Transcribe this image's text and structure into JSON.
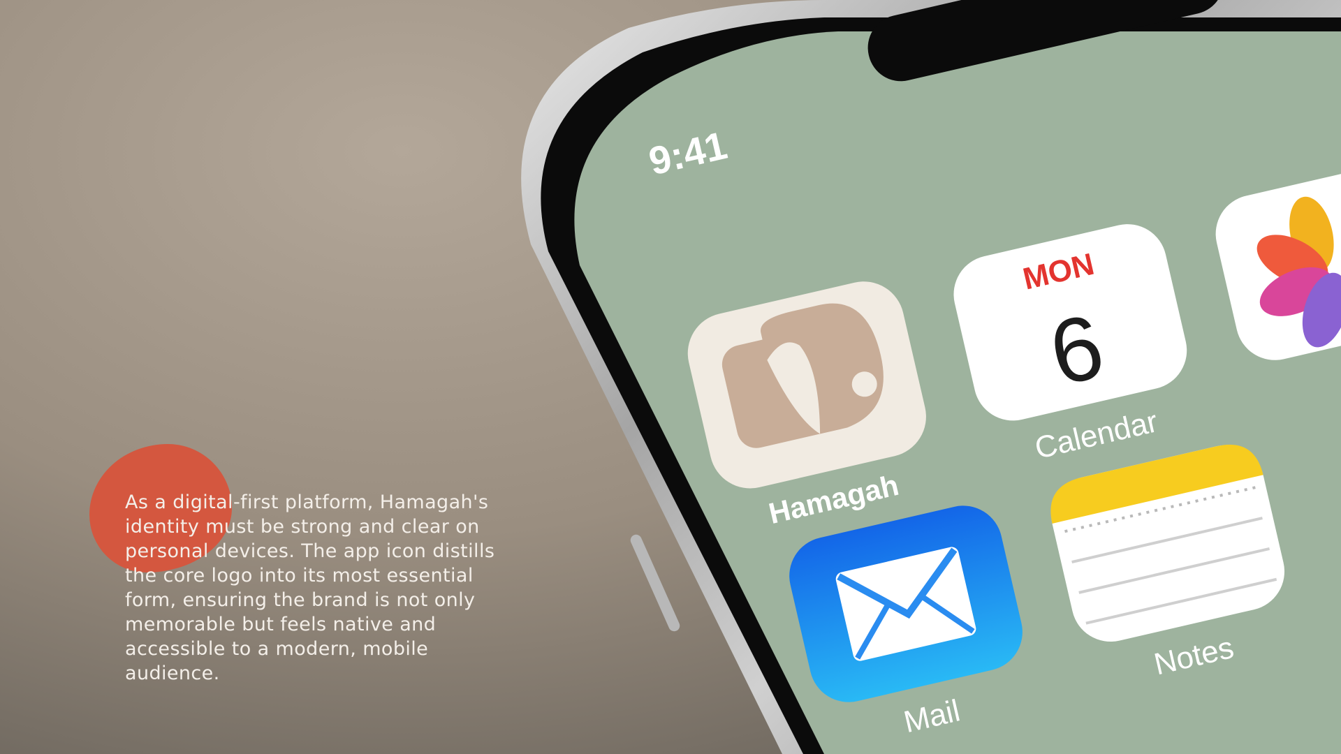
{
  "caption": {
    "text": "As a digital-first platform, Hamagah's identity must be strong and clear on personal devices. The app icon distills the core logo into its most essential form, ensuring the brand is not only memorable but feels native and accessible to a modern, mobile audience."
  },
  "status_bar": {
    "time": "9:41"
  },
  "apps": {
    "hamagah": {
      "label": "Hamagah",
      "icon": "hamagah-logo-icon"
    },
    "calendar": {
      "label": "Calendar",
      "day": "MON",
      "date": "6",
      "icon": "calendar-icon"
    },
    "photos": {
      "label": "",
      "icon": "photos-icon"
    },
    "mail": {
      "label": "Mail",
      "icon": "mail-icon"
    },
    "notes": {
      "label": "Notes",
      "icon": "notes-icon"
    }
  },
  "colors": {
    "screen": "#9eb39e",
    "accent_blob": "#d4573f",
    "hamagah_tile": "#f1ebe2",
    "hamagah_logo": "#c8ad98",
    "calendar_red": "#e3342f",
    "mail_blue": "#1a7ef0",
    "notes_yellow": "#f7cc1f"
  }
}
